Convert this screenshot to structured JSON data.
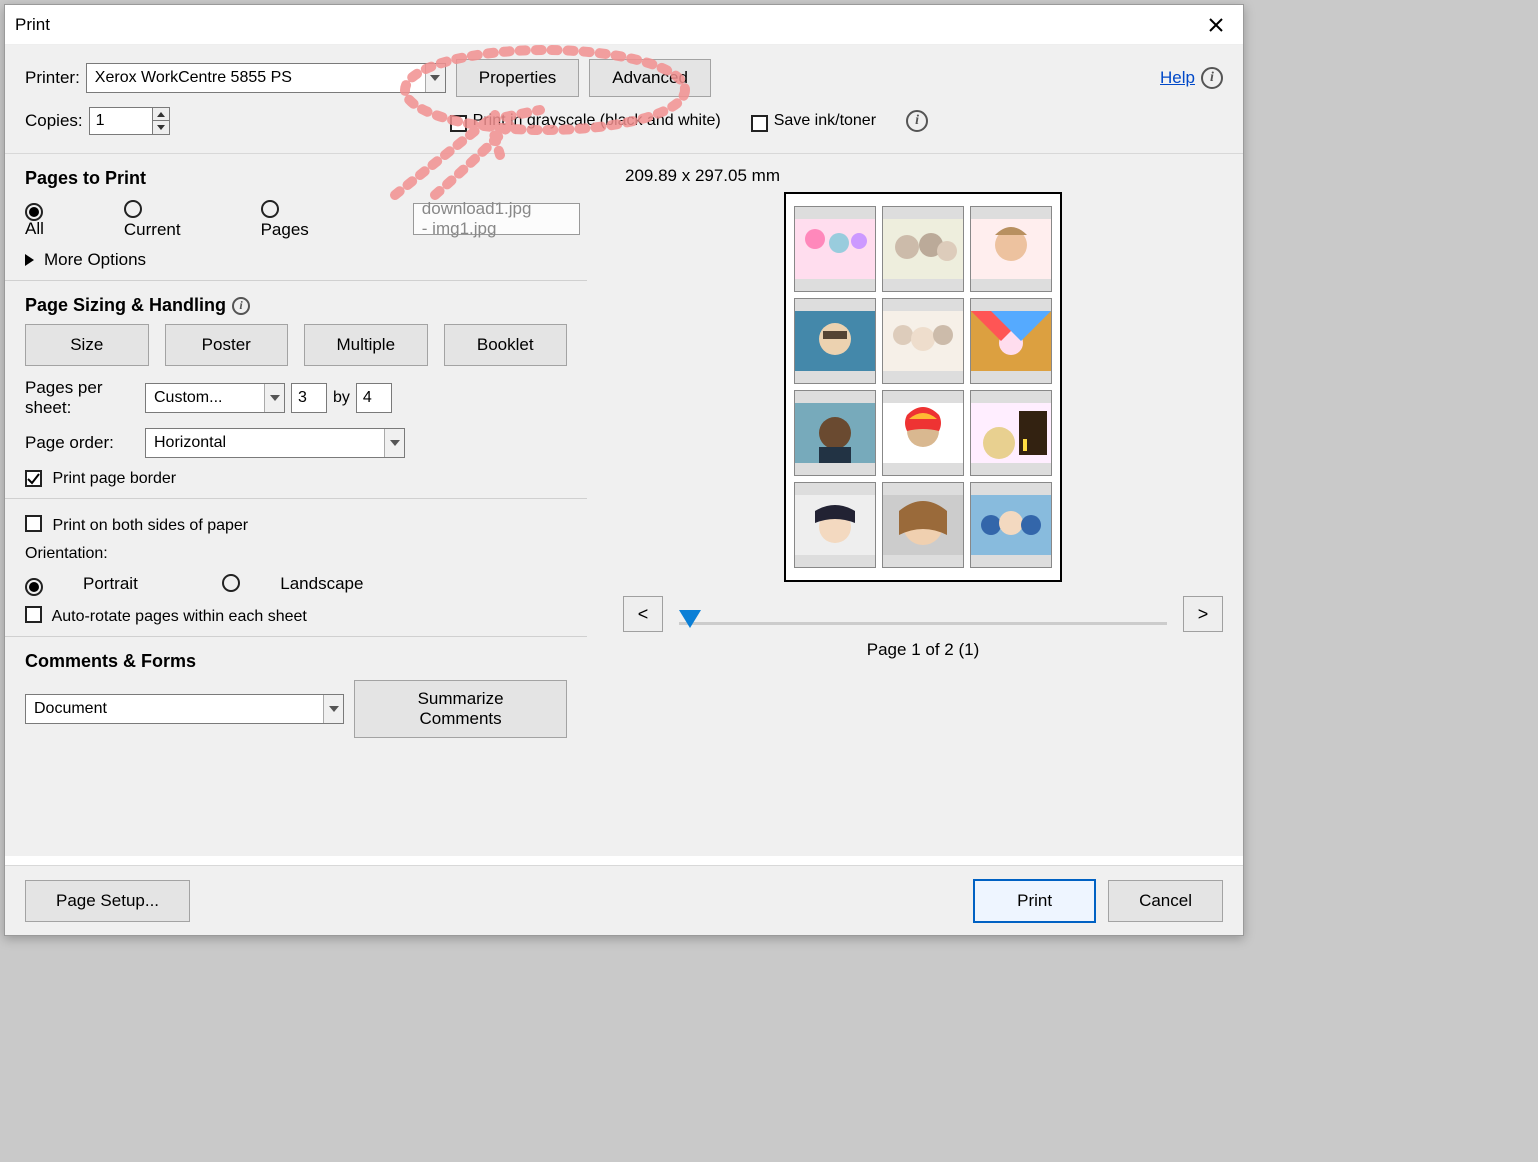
{
  "dialog": {
    "title": "Print"
  },
  "top": {
    "printer_label": "Printer:",
    "printer_value": "Xerox WorkCentre 5855 PS",
    "properties_btn": "Properties",
    "advanced_btn": "Advanced",
    "help_link": "Help",
    "copies_label": "Copies:",
    "copies_value": "1",
    "grayscale_label": "Print in grayscale (black and white)",
    "saveink_label": "Save ink/toner"
  },
  "pages": {
    "title": "Pages to Print",
    "all": "All",
    "current": "Current",
    "pages": "Pages",
    "range_placeholder": "download1.jpg - img1.jpg",
    "more": "More Options"
  },
  "sizing": {
    "title": "Page Sizing & Handling",
    "tabs": {
      "size": "Size",
      "poster": "Poster",
      "multiple": "Multiple",
      "booklet": "Booklet"
    },
    "pps_label": "Pages per sheet:",
    "pps_value": "Custom...",
    "pps_cols": "3",
    "pps_by": "by",
    "pps_rows": "4",
    "order_label": "Page order:",
    "order_value": "Horizontal",
    "border_label": "Print page border"
  },
  "duplex": {
    "both_sides": "Print on both sides of paper",
    "orientation": "Orientation:",
    "portrait": "Portrait",
    "landscape": "Landscape",
    "autorotate": "Auto-rotate pages within each sheet"
  },
  "comments": {
    "title": "Comments & Forms",
    "value": "Document",
    "summarize": "Summarize Comments"
  },
  "preview": {
    "dims": "209.89 x 297.05 mm",
    "prev": "<",
    "next": ">",
    "status": "Page 1 of 2 (1)"
  },
  "footer": {
    "page_setup": "Page Setup...",
    "print": "Print",
    "cancel": "Cancel"
  }
}
